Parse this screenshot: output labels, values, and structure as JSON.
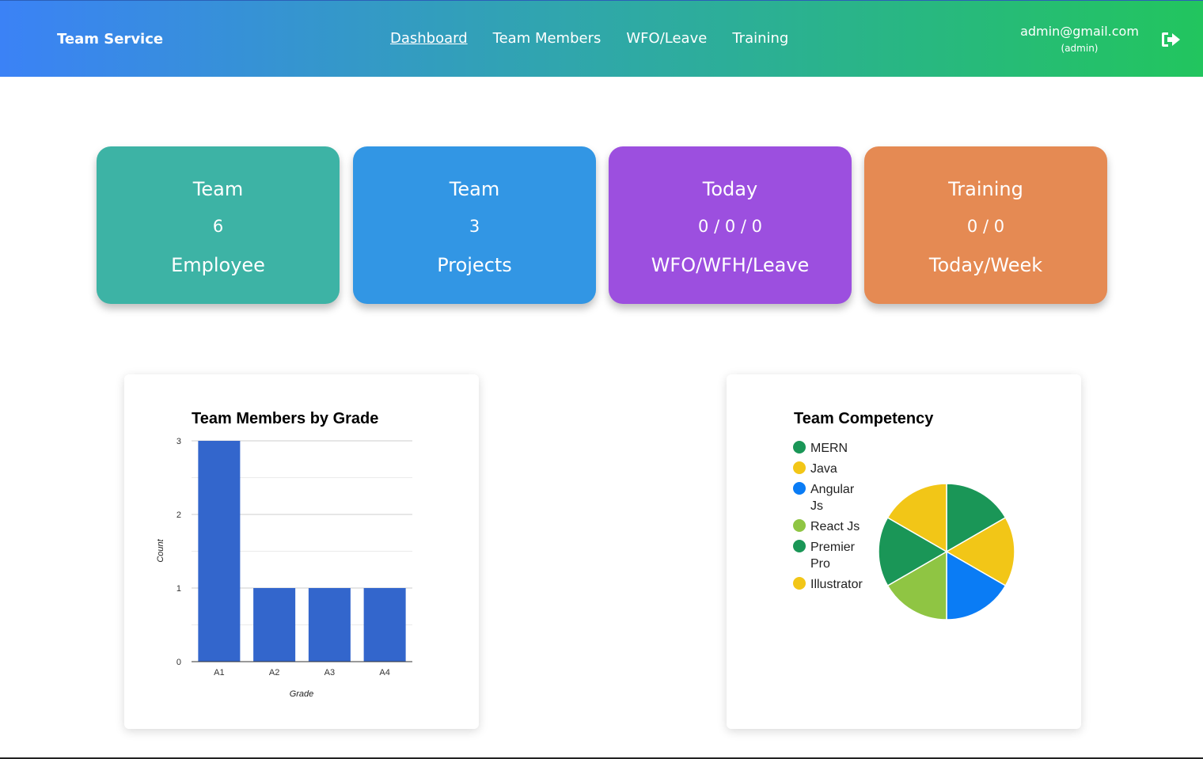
{
  "header": {
    "brand": "Team Service",
    "nav": [
      {
        "label": "Dashboard",
        "active": true
      },
      {
        "label": "Team Members",
        "active": false
      },
      {
        "label": "WFO/Leave",
        "active": false
      },
      {
        "label": "Training",
        "active": false
      }
    ],
    "user_email": "admin@gmail.com",
    "user_role": "(admin)",
    "logout_icon": "sign-out-icon"
  },
  "cards": [
    {
      "line1": "Team",
      "line2": "6",
      "line3": "Employee",
      "color": "#3db3a5"
    },
    {
      "line1": "Team",
      "line2": "3",
      "line3": "Projects",
      "color": "#3296e4"
    },
    {
      "line1": "Today",
      "line2": "0 / 0 / 0",
      "line3": "WFO/WFH/Leave",
      "color": "#9c4fdf"
    },
    {
      "line1": "Training",
      "line2": "0 / 0",
      "line3": "Today/Week",
      "color": "#e58a53"
    }
  ],
  "chart_data": [
    {
      "type": "bar",
      "title": "Team Members by Grade",
      "xlabel": "Grade",
      "ylabel": "Count",
      "categories": [
        "A1",
        "A2",
        "A3",
        "A4"
      ],
      "values": [
        3,
        1,
        1,
        1
      ],
      "ylim": [
        0,
        3
      ],
      "yticks": [
        0,
        1,
        2,
        3
      ],
      "grid": true,
      "color": "#3366cc"
    },
    {
      "type": "pie",
      "title": "Team Competency",
      "labels": [
        "MERN",
        "Java",
        "Angular Js",
        "React Js",
        "Premier Pro",
        "Illustrator"
      ],
      "legend_lines": [
        [
          "MERN"
        ],
        [
          "Java"
        ],
        [
          "Angular",
          "Js"
        ],
        [
          "React Js"
        ],
        [
          "Premier",
          "Pro"
        ],
        [
          "Illustrator"
        ]
      ],
      "values": [
        1,
        1,
        1,
        1,
        1,
        1
      ],
      "colors": [
        "#1a9657",
        "#f2c617",
        "#0a7cf5",
        "#8fc543",
        "#1a9657",
        "#f2c617"
      ],
      "legend": "left"
    }
  ]
}
